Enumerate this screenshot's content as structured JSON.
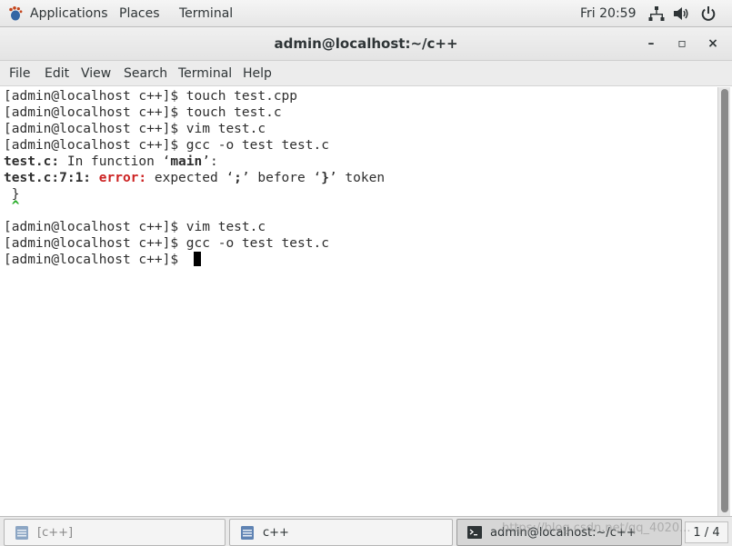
{
  "top_panel": {
    "applications_label": "Applications",
    "places_label": "Places",
    "terminal_label": "Terminal",
    "clock": "Fri 20:59"
  },
  "window": {
    "title": "admin@localhost:~/c++",
    "minimize_glyph": "–",
    "maximize_glyph": "▫",
    "close_glyph": "×"
  },
  "menubar": {
    "items": [
      "File",
      "Edit",
      "View",
      "Search",
      "Terminal",
      "Help"
    ]
  },
  "terminal": {
    "prompt": "[admin@localhost c++]$ ",
    "lines": [
      {
        "prompt": "[admin@localhost c++]$ ",
        "cmd": "touch test.cpp"
      },
      {
        "prompt": "[admin@localhost c++]$ ",
        "cmd": "touch test.c"
      },
      {
        "prompt": "[admin@localhost c++]$ ",
        "cmd": "vim test.c"
      },
      {
        "prompt": "[admin@localhost c++]$ ",
        "cmd": "gcc -o test test.c"
      }
    ],
    "diag1": {
      "file": "test.c:",
      "text": " In function ‘",
      "func": "main",
      "end": "’:"
    },
    "diag2": {
      "loc": "test.c:7:1:",
      "err": " error:",
      "text1": " expected ‘",
      "sym1": ";",
      "text2": "’ before ‘",
      "sym2": "}",
      "text3": "’ token"
    },
    "diag3": " }",
    "diag4": " ^",
    "lines2": [
      {
        "prompt": "[admin@localhost c++]$ ",
        "cmd": "vim test.c"
      },
      {
        "prompt": "[admin@localhost c++]$ ",
        "cmd": "gcc -o test test.c"
      },
      {
        "prompt": "[admin@localhost c++]$ ",
        "cmd": ""
      }
    ]
  },
  "taskbar": {
    "tasks": [
      {
        "label": "[c++]",
        "state": "minimized"
      },
      {
        "label": "c++",
        "state": "normal"
      },
      {
        "label": "admin@localhost:~/c++",
        "state": "active"
      }
    ],
    "workspace": "1 / 4",
    "watermark": "https://blog.csdn.net/qq_4020..."
  },
  "colors": {
    "error": "#cc2222",
    "caret": "#22aa22",
    "terminal_bg": "#ffffff",
    "panel_bg": "#e6e6e6"
  },
  "icons": {
    "applications": "gnome-foot-icon",
    "network": "network-icon",
    "volume": "volume-icon",
    "power": "power-icon",
    "folder": "folder-icon",
    "terminal": "terminal-icon"
  }
}
